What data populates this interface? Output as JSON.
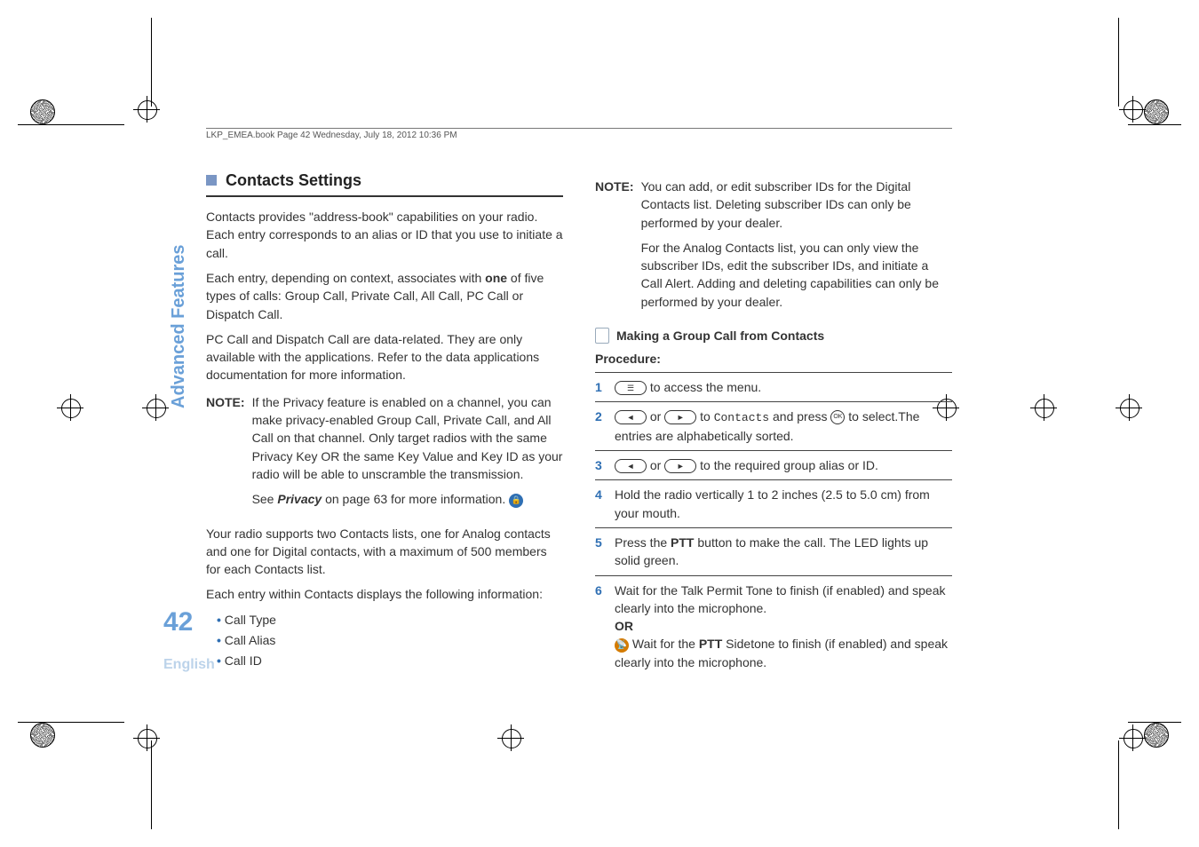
{
  "header": "LKP_EMEA.book  Page 42  Wednesday, July 18, 2012  10:36 PM",
  "sideTab": "Advanced Features",
  "pageNumber": "42",
  "language": "English",
  "left": {
    "sectionTitle": "Contacts Settings",
    "p1": "Contacts provides \"address-book\" capabilities on your radio. Each entry corresponds to an alias or ID that you use to initiate a call.",
    "p2a": "Each entry, depending on context, associates with ",
    "p2bold": "one",
    "p2b": " of five types of calls: Group Call, Private Call, All Call, PC Call or Dispatch Call.",
    "p3": "PC Call and Dispatch Call are data-related. They are only available with the applications. Refer to the data applications documentation for more information.",
    "noteLabel": "NOTE:",
    "note1": "If the Privacy feature is enabled on a channel, you can make privacy-enabled Group Call, Private Call, and All Call on that channel. Only target radios with the same Privacy Key OR the same Key Value and Key ID as your radio will be able to unscramble the transmission.",
    "note2a": "See ",
    "note2link": "Privacy",
    "note2b": " on page 63 for more information.",
    "p4": "Your radio supports two Contacts lists, one for Analog contacts and one for Digital contacts, with a maximum of 500 members for each Contacts list.",
    "p5": "Each entry within Contacts displays the following information:",
    "bullets": [
      "Call Type",
      "Call Alias",
      "Call ID"
    ]
  },
  "right": {
    "noteLabel": "NOTE:",
    "note1": "You can add, or edit subscriber IDs for the Digital Contacts list. Deleting subscriber IDs can only be performed by your dealer.",
    "note2": "For the Analog Contacts list, you can only view the subscriber IDs, edit the subscriber IDs, and initiate a Call Alert. Adding and deleting capabilities can only be performed by your dealer.",
    "subHeading": "Making a Group Call from Contacts",
    "procedure": "Procedure:",
    "steps": {
      "s1": " to access the menu.",
      "s2a": " or ",
      "s2b": " to ",
      "s2contacts": "Contacts",
      "s2c": " and press ",
      "s2d": " to select.The entries are alphabetically sorted.",
      "s3a": " or ",
      "s3b": " to the required group alias or ID.",
      "s4": "Hold the radio vertically 1 to 2 inches (2.5 to 5.0 cm) from your mouth.",
      "s5a": "Press the ",
      "s5ptt": "PTT",
      "s5b": " button to make the call. The LED lights up solid green.",
      "s6a": "Wait for the Talk Permit Tone to finish (if enabled) and speak clearly into the microphone.",
      "s6or": "OR",
      "s6b1": "Wait for the ",
      "s6ptt": "PTT",
      "s6b2": " Sidetone to finish (if enabled) and speak clearly into the microphone."
    }
  }
}
